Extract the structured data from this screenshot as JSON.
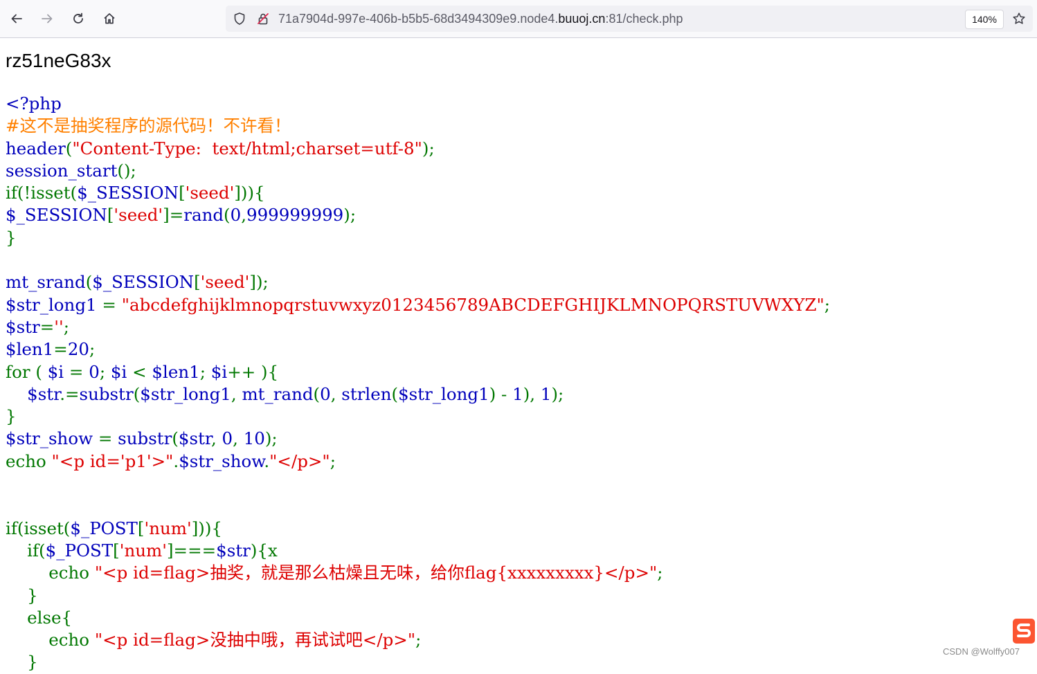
{
  "browser": {
    "back_icon": "arrow-left-icon",
    "forward_icon": "arrow-right-icon",
    "reload_icon": "reload-icon",
    "home_icon": "home-icon",
    "url_prefix": "71a7904d-997e-406b-b5b5-68d3494309e9.node4.",
    "url_domain": "buuoj.cn",
    "url_suffix": ":81/check.php",
    "zoom": "140%",
    "bookmark_icon": "star-icon"
  },
  "page": {
    "random_text": "rz51neG83x"
  },
  "code": [
    [
      {
        "c": "def",
        "t": "<?php"
      }
    ],
    [
      {
        "c": "cm",
        "t": "#这不是抽奖程序的源代码！不许看！"
      }
    ],
    [
      {
        "c": "def",
        "t": "header"
      },
      {
        "c": "kw",
        "t": "("
      },
      {
        "c": "str",
        "t": "\"Content-Type:  text/html;charset=utf-8\""
      },
      {
        "c": "kw",
        "t": ");"
      }
    ],
    [
      {
        "c": "def",
        "t": "session_start"
      },
      {
        "c": "kw",
        "t": "();"
      }
    ],
    [
      {
        "c": "kw",
        "t": "if(!isset("
      },
      {
        "c": "def",
        "t": "$_SESSION"
      },
      {
        "c": "kw",
        "t": "["
      },
      {
        "c": "str",
        "t": "'seed'"
      },
      {
        "c": "kw",
        "t": "])){"
      }
    ],
    [
      {
        "c": "def",
        "t": "$_SESSION"
      },
      {
        "c": "kw",
        "t": "["
      },
      {
        "c": "str",
        "t": "'seed'"
      },
      {
        "c": "kw",
        "t": "]="
      },
      {
        "c": "def",
        "t": "rand"
      },
      {
        "c": "kw",
        "t": "("
      },
      {
        "c": "def",
        "t": "0"
      },
      {
        "c": "kw",
        "t": ","
      },
      {
        "c": "def",
        "t": "999999999"
      },
      {
        "c": "kw",
        "t": ");"
      }
    ],
    [
      {
        "c": "kw",
        "t": "}"
      }
    ],
    [],
    [
      {
        "c": "def",
        "t": "mt_srand"
      },
      {
        "c": "kw",
        "t": "("
      },
      {
        "c": "def",
        "t": "$_SESSION"
      },
      {
        "c": "kw",
        "t": "["
      },
      {
        "c": "str",
        "t": "'seed'"
      },
      {
        "c": "kw",
        "t": "]);"
      }
    ],
    [
      {
        "c": "def",
        "t": "$str_long1 "
      },
      {
        "c": "kw",
        "t": "= "
      },
      {
        "c": "str",
        "t": "\"abcdefghijklmnopqrstuvwxyz0123456789ABCDEFGHIJKLMNOPQRSTUVWXYZ\""
      },
      {
        "c": "kw",
        "t": ";"
      }
    ],
    [
      {
        "c": "def",
        "t": "$str"
      },
      {
        "c": "kw",
        "t": "="
      },
      {
        "c": "str",
        "t": "''"
      },
      {
        "c": "kw",
        "t": ";"
      }
    ],
    [
      {
        "c": "def",
        "t": "$len1"
      },
      {
        "c": "kw",
        "t": "="
      },
      {
        "c": "def",
        "t": "20"
      },
      {
        "c": "kw",
        "t": ";"
      }
    ],
    [
      {
        "c": "kw",
        "t": "for ( "
      },
      {
        "c": "def",
        "t": "$i "
      },
      {
        "c": "kw",
        "t": "= "
      },
      {
        "c": "def",
        "t": "0"
      },
      {
        "c": "kw",
        "t": "; "
      },
      {
        "c": "def",
        "t": "$i "
      },
      {
        "c": "kw",
        "t": "< "
      },
      {
        "c": "def",
        "t": "$len1"
      },
      {
        "c": "kw",
        "t": "; "
      },
      {
        "c": "def",
        "t": "$i"
      },
      {
        "c": "kw",
        "t": "++ ){"
      }
    ],
    [
      {
        "c": "kw",
        "t": "    "
      },
      {
        "c": "def",
        "t": "$str"
      },
      {
        "c": "kw",
        "t": ".="
      },
      {
        "c": "def",
        "t": "substr"
      },
      {
        "c": "kw",
        "t": "("
      },
      {
        "c": "def",
        "t": "$str_long1"
      },
      {
        "c": "kw",
        "t": ", "
      },
      {
        "c": "def",
        "t": "mt_rand"
      },
      {
        "c": "kw",
        "t": "("
      },
      {
        "c": "def",
        "t": "0"
      },
      {
        "c": "kw",
        "t": ", "
      },
      {
        "c": "def",
        "t": "strlen"
      },
      {
        "c": "kw",
        "t": "("
      },
      {
        "c": "def",
        "t": "$str_long1"
      },
      {
        "c": "kw",
        "t": ") - "
      },
      {
        "c": "def",
        "t": "1"
      },
      {
        "c": "kw",
        "t": "), "
      },
      {
        "c": "def",
        "t": "1"
      },
      {
        "c": "kw",
        "t": ");"
      }
    ],
    [
      {
        "c": "kw",
        "t": "}"
      }
    ],
    [
      {
        "c": "def",
        "t": "$str_show "
      },
      {
        "c": "kw",
        "t": "= "
      },
      {
        "c": "def",
        "t": "substr"
      },
      {
        "c": "kw",
        "t": "("
      },
      {
        "c": "def",
        "t": "$str"
      },
      {
        "c": "kw",
        "t": ", "
      },
      {
        "c": "def",
        "t": "0"
      },
      {
        "c": "kw",
        "t": ", "
      },
      {
        "c": "def",
        "t": "10"
      },
      {
        "c": "kw",
        "t": ");"
      }
    ],
    [
      {
        "c": "kw",
        "t": "echo "
      },
      {
        "c": "str",
        "t": "\"<p id='p1'>\""
      },
      {
        "c": "kw",
        "t": "."
      },
      {
        "c": "def",
        "t": "$str_show"
      },
      {
        "c": "kw",
        "t": "."
      },
      {
        "c": "str",
        "t": "\"</p>\""
      },
      {
        "c": "kw",
        "t": ";"
      }
    ],
    [],
    [],
    [
      {
        "c": "kw",
        "t": "if(isset("
      },
      {
        "c": "def",
        "t": "$_POST"
      },
      {
        "c": "kw",
        "t": "["
      },
      {
        "c": "str",
        "t": "'num'"
      },
      {
        "c": "kw",
        "t": "])){"
      }
    ],
    [
      {
        "c": "kw",
        "t": "    if("
      },
      {
        "c": "def",
        "t": "$_POST"
      },
      {
        "c": "kw",
        "t": "["
      },
      {
        "c": "str",
        "t": "'num'"
      },
      {
        "c": "kw",
        "t": "]==="
      },
      {
        "c": "def",
        "t": "$str"
      },
      {
        "c": "kw",
        "t": "){x"
      }
    ],
    [
      {
        "c": "kw",
        "t": "        echo "
      },
      {
        "c": "str",
        "t": "\"<p id=flag>抽奖，就是那么枯燥且无味，给你flag{xxxxxxxxx}</p>\""
      },
      {
        "c": "kw",
        "t": ";"
      }
    ],
    [
      {
        "c": "kw",
        "t": "    }"
      }
    ],
    [
      {
        "c": "kw",
        "t": "    else{"
      }
    ],
    [
      {
        "c": "kw",
        "t": "        echo "
      },
      {
        "c": "str",
        "t": "\"<p id=flag>没抽中哦，再试试吧</p>\""
      },
      {
        "c": "kw",
        "t": ";"
      }
    ],
    [
      {
        "c": "kw",
        "t": "    }"
      }
    ]
  ],
  "colors": {
    "default": "#0000bb",
    "keyword": "#007700",
    "string": "#dd0000",
    "comment": "#ff8000"
  },
  "watermark": {
    "text": "CSDN @Wolffy007",
    "logo_icon": "csdn-logo-icon"
  }
}
